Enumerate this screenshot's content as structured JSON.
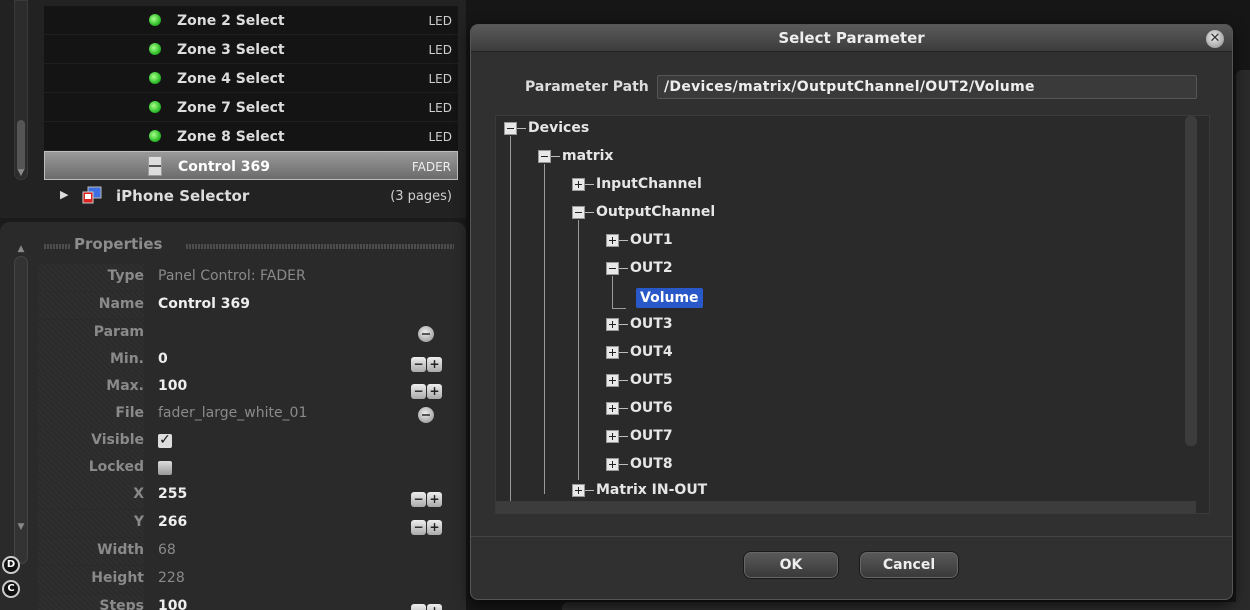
{
  "controls": {
    "rows": [
      {
        "label": "Zone 2 Select",
        "type": "LED"
      },
      {
        "label": "Zone 3 Select",
        "type": "LED"
      },
      {
        "label": "Zone 4 Select",
        "type": "LED"
      },
      {
        "label": "Zone 7 Select",
        "type": "LED"
      },
      {
        "label": "Zone 8 Select",
        "type": "LED"
      }
    ],
    "selected": {
      "label": "Control 369",
      "type": "FADER"
    },
    "page": {
      "label": "iPhone Selector",
      "pages": "(3 pages)"
    },
    "colors": {
      "led": "#2fbf2a"
    }
  },
  "properties": {
    "title": "Properties",
    "fields": {
      "type": {
        "key": "Type",
        "value": "Panel Control: FADER"
      },
      "name": {
        "key": "Name",
        "value": "Control 369"
      },
      "param": {
        "key": "Param",
        "value": ""
      },
      "min": {
        "key": "Min.",
        "value": "0"
      },
      "max": {
        "key": "Max.",
        "value": "100"
      },
      "file": {
        "key": "File",
        "value": "fader_large_white_01"
      },
      "visible": {
        "key": "Visible",
        "checked": true
      },
      "locked": {
        "key": "Locked",
        "checked": false
      },
      "x": {
        "key": "X",
        "value": "255"
      },
      "y": {
        "key": "Y",
        "value": "266"
      },
      "width": {
        "key": "Width",
        "value": "68"
      },
      "height": {
        "key": "Height",
        "value": "228"
      },
      "steps": {
        "key": "Steps",
        "value": "100"
      }
    },
    "badges": {
      "d": "D",
      "c": "C"
    }
  },
  "dialog": {
    "title": "Select Parameter",
    "path_label": "Parameter Path",
    "path_value": "/Devices/matrix/OutputChannel/OUT2/Volume",
    "tree": {
      "devices": "Devices",
      "matrix": "matrix",
      "input_channel": "InputChannel",
      "output_channel": "OutputChannel",
      "out1": "OUT1",
      "out2": "OUT2",
      "volume": "Volume",
      "out3": "OUT3",
      "out4": "OUT4",
      "out5": "OUT5",
      "out6": "OUT6",
      "out7": "OUT7",
      "out8": "OUT8",
      "matrix_in_out": "Matrix IN-OUT"
    },
    "ok_label": "OK",
    "cancel_label": "Cancel",
    "colors": {
      "selection": "#2958c8"
    }
  }
}
